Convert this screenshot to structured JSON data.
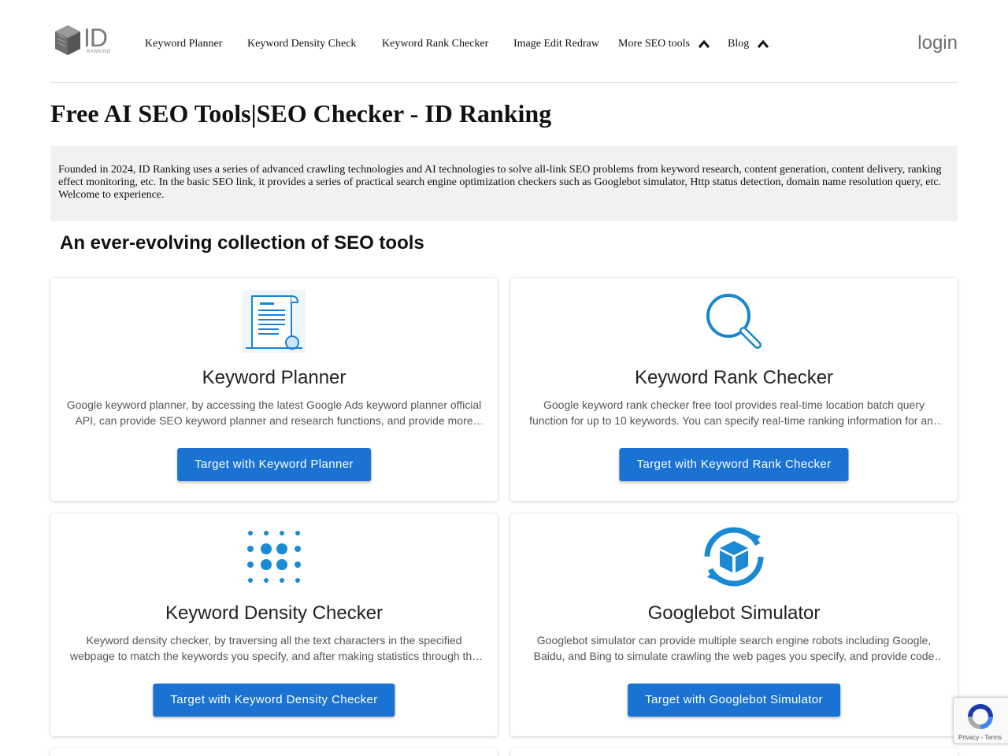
{
  "header": {
    "logo_text": "ID",
    "logo_subtext": "RANKING",
    "nav": [
      {
        "label": "Keyword Planner"
      },
      {
        "label": "Keyword Density Check"
      },
      {
        "label": "Keyword Rank Checker"
      },
      {
        "label": "Image Edit Redraw"
      },
      {
        "label": "More SEO tools",
        "icon": "chevron-up-icon"
      },
      {
        "label": "Blog",
        "icon": "chevron-up-icon"
      }
    ],
    "login": "login"
  },
  "page_title": "Free AI SEO Tools|SEO Checker - ID Ranking",
  "intro": "Founded in 2024, ID Ranking uses a series of advanced crawling technologies and AI technologies to solve all-link SEO problems from keyword research, content generation, content delivery, ranking effect monitoring, etc. In the basic SEO link, it provides a series of practical search engine optimization checkers such as Googlebot simulator, Http status detection, domain name resolution query, etc. Welcome to experience.",
  "subtitle": "An ever-evolving collection of SEO tools",
  "accent_color": "#1a73d2",
  "cards": [
    {
      "icon": "document-certificate-icon",
      "title": "Keyword Planner",
      "desc": "Google keyword planner, by accessing the latest Google Ads keyword planner official API, can provide SEO keyword planner and research functions, and provide more accurate keyword data.",
      "button": "Target with Keyword Planner"
    },
    {
      "icon": "magnifier-icon",
      "title": "Keyword Rank Checker",
      "desc": "Google keyword rank checker free tool provides real-time location batch query function for up to 10 keywords. You can specify real-time ranking information for any location.",
      "button": "Target with Keyword Rank Checker"
    },
    {
      "icon": "dots-grid-icon",
      "title": "Keyword Density Checker",
      "desc": "Keyword density checker, by traversing all the text characters in the specified webpage to match the keywords you specify, and after making statistics through the algorithm.",
      "button": "Target with Keyword Density Checker"
    },
    {
      "icon": "box-sync-icon",
      "title": "Googlebot Simulator",
      "desc": "Googlebot simulator can provide multiple search engine robots including Google, Baidu, and Bing to simulate crawling the web pages you specify, and provide code analysis.",
      "button": "Target with Googlebot Simulator"
    }
  ],
  "recaptcha": {
    "text": "Privacy - Terms"
  }
}
